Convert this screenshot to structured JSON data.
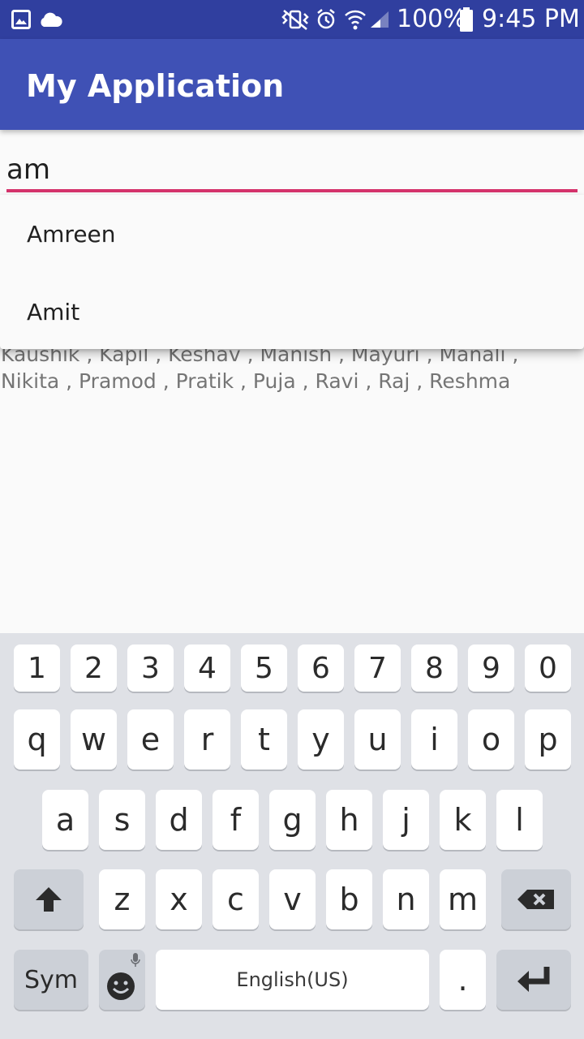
{
  "status_bar": {
    "battery_percent": "100%",
    "time": "9:45 PM",
    "icons": [
      "gallery-icon",
      "cloud-icon",
      "vibrate-icon",
      "alarm-icon",
      "wifi-icon",
      "signal-icon",
      "battery-icon"
    ]
  },
  "app_bar": {
    "title": "My Application"
  },
  "search": {
    "value": "am"
  },
  "names_text": "Kaushik , Kapil , Keshav , Manish , Mayuri , Manali , Nikita , Pramod , Pratik , Puja , Ravi , Raj , Reshma",
  "dropdown": {
    "items": [
      "Amreen",
      "Amit"
    ]
  },
  "keyboard": {
    "digits": [
      "1",
      "2",
      "3",
      "4",
      "5",
      "6",
      "7",
      "8",
      "9",
      "0"
    ],
    "row1": [
      "q",
      "w",
      "e",
      "r",
      "t",
      "y",
      "u",
      "i",
      "o",
      "p"
    ],
    "row2": [
      "a",
      "s",
      "d",
      "f",
      "g",
      "h",
      "j",
      "k",
      "l"
    ],
    "row3": [
      "z",
      "x",
      "c",
      "v",
      "b",
      "n",
      "m"
    ],
    "sym_label": "Sym",
    "space_label": "English(US)",
    "period_label": "."
  },
  "colors": {
    "status_bar": "#303f9f",
    "app_bar": "#3f51b5",
    "accent": "#d6336c"
  }
}
